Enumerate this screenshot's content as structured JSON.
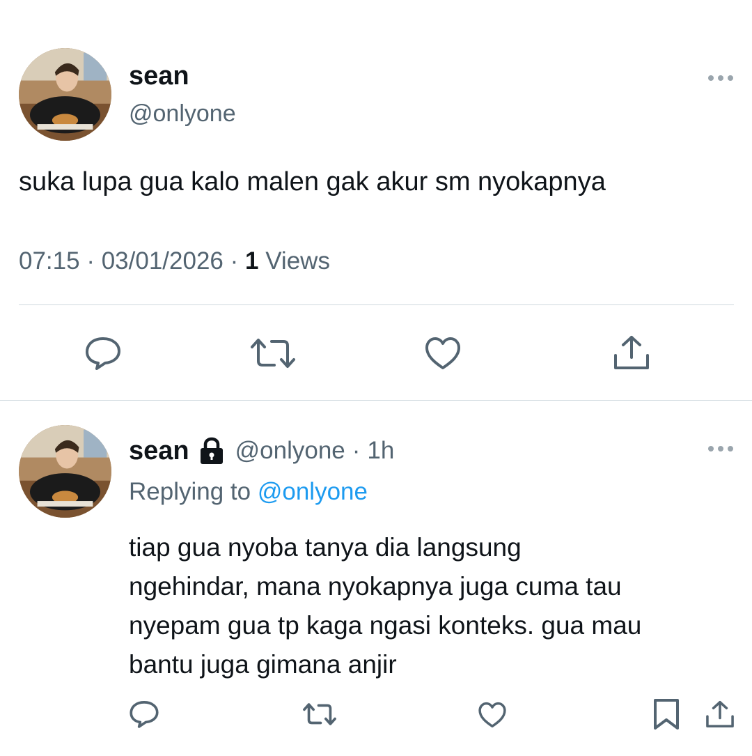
{
  "main_tweet": {
    "display_name": "sean",
    "handle": "@onlyone",
    "text": "suka lupa gua kalo malen gak akur sm nyokapnya",
    "time": "07:15",
    "separator": "·",
    "date": "03/01/2026",
    "views_count": "1",
    "views_label": "Views",
    "actions": [
      "reply-icon",
      "retweet-icon",
      "like-icon",
      "share-icon"
    ]
  },
  "reply_tweet": {
    "display_name": "sean",
    "handle": "@onlyone",
    "separator": "·",
    "age": "1h",
    "replying_prefix": "Replying to",
    "replying_handle": "@onlyone",
    "text_lines": [
      "tiap gua nyoba tanya dia langsung",
      "ngehindar, mana nyokapnya juga cuma tau",
      "nyepam gua tp kaga ngasi konteks. gua mau",
      "bantu juga gimana anjir"
    ],
    "actions": [
      "reply-icon",
      "retweet-icon",
      "like-icon",
      "bookmark-icon",
      "share-icon"
    ]
  },
  "colors": {
    "text": "#0f1419",
    "secondary": "#536471",
    "link": "#1d9bf0",
    "divider": "#cfd9de"
  }
}
